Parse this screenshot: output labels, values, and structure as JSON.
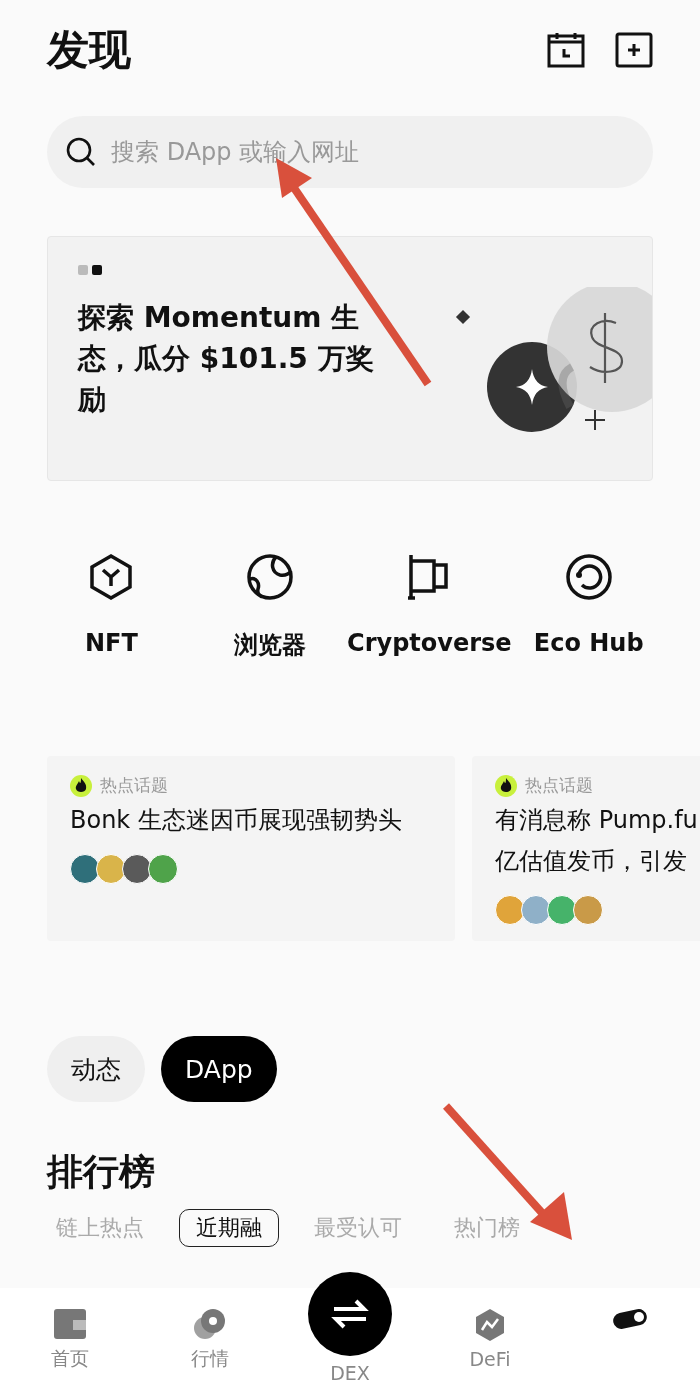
{
  "header": {
    "title": "发现"
  },
  "search": {
    "placeholder": "搜索 DApp 或输入网址"
  },
  "banner": {
    "title": "探索 Momentum 生态，瓜分 $101.5 万奖励",
    "pages": [
      {
        "selected": false
      },
      {
        "selected": true
      }
    ]
  },
  "shortcuts": [
    {
      "label": "NFT",
      "kind": "cube"
    },
    {
      "label": "浏览器",
      "kind": "globe"
    },
    {
      "label": "Cryptoverse",
      "kind": "flag"
    },
    {
      "label": "Eco Hub",
      "kind": "ring"
    }
  ],
  "topics": [
    {
      "tag": "热点话题",
      "lines": [
        "Bonk 生态迷因币展现强韧势头"
      ]
    },
    {
      "tag": "热点话题",
      "lines": [
        "有消息称 Pump.fu",
        "亿估值发币，引发"
      ]
    }
  ],
  "feed_tabs": [
    {
      "label": "动态",
      "selected": false
    },
    {
      "label": "DApp",
      "selected": true
    }
  ],
  "ranking": {
    "title": "排行榜",
    "tabs": [
      {
        "label": "链上热点",
        "selected": false
      },
      {
        "label": "近期融",
        "selected": true
      },
      {
        "label": "最受认可",
        "selected": false
      },
      {
        "label": "热门榜",
        "selected": false
      }
    ]
  },
  "nav": [
    {
      "label": "首页",
      "kind": "wallet",
      "selected": false
    },
    {
      "label": "行情",
      "kind": "coins",
      "selected": false
    },
    {
      "label": "DEX",
      "kind": "swap",
      "selected": false
    },
    {
      "label": "DeFi",
      "kind": "hexagon",
      "selected": false
    },
    {
      "kind": "toggle",
      "selected": true
    }
  ]
}
